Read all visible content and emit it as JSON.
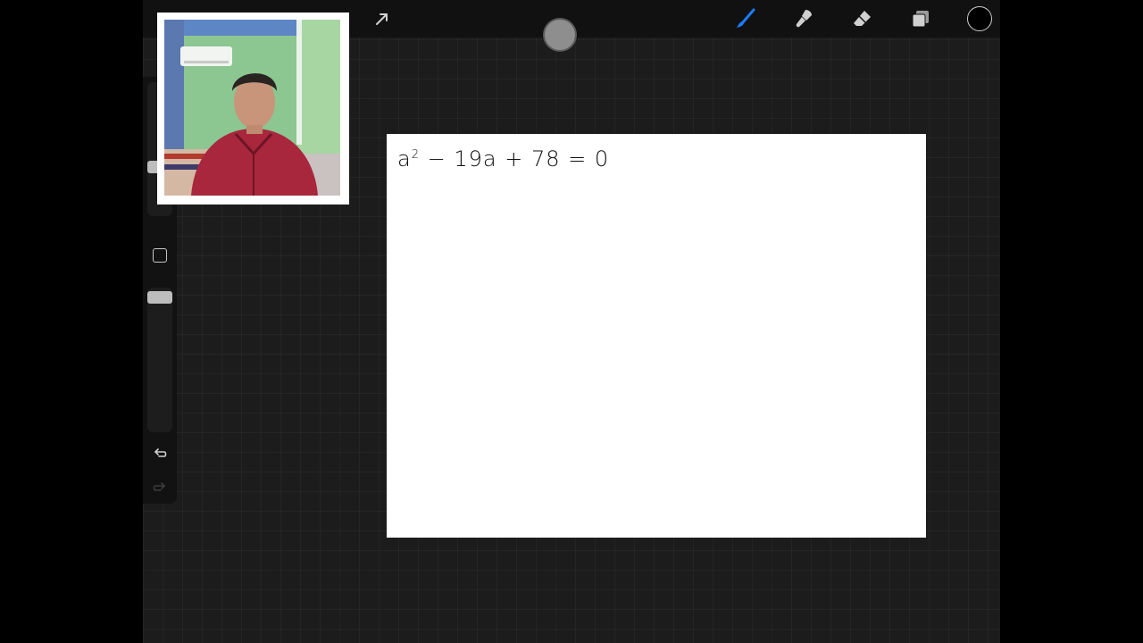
{
  "toolbar": {
    "icons": [
      "transform-icon",
      "brush-icon",
      "smudge-icon",
      "eraser-icon",
      "layers-icon",
      "color-swatch"
    ],
    "accent_color": "#1a7cff",
    "current_color": "#000000"
  },
  "sidebar": {
    "brush_size_level": 0.1,
    "opacity_level": 0.05
  },
  "canvas": {
    "equation_base": "a",
    "equation_exponent": "2",
    "equation_rest": " − 19a + 78 = 0"
  }
}
